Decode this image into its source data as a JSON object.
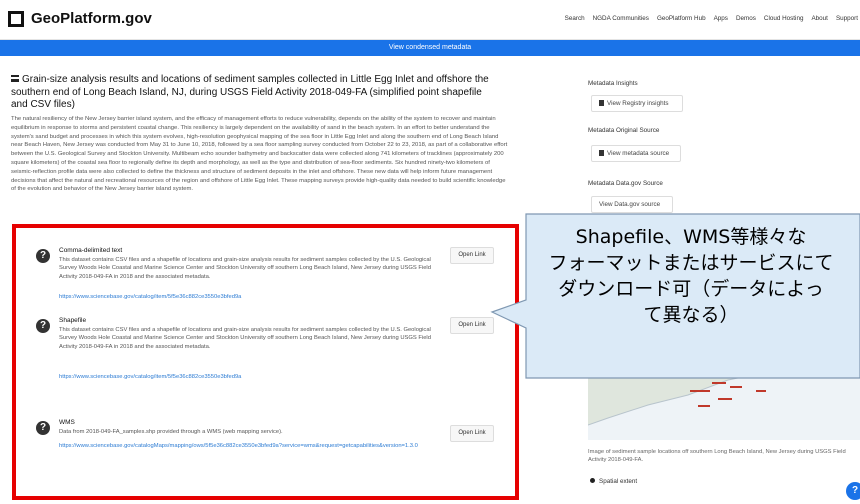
{
  "header": {
    "logo_text": "GeoPlatform.gov",
    "nav": [
      "Search",
      "NGDA Communities",
      "GeoPlatform Hub",
      "Apps",
      "Demos",
      "Cloud Hosting",
      "About",
      "Support"
    ]
  },
  "condensed_bar": "View condensed metadata",
  "main": {
    "title": "Grain-size analysis results and locations of sediment samples collected in Little Egg Inlet and offshore the southern end of Long Beach Island, NJ, during USGS Field Activity 2018-049-FA (simplified point shapefile and CSV files)",
    "description": "The natural resiliency of the New Jersey barrier island system, and the efficacy of management efforts to reduce vulnerability, depends on the ability of the system to recover and maintain equilibrium in response to storms and persistent coastal change. This resiliency is largely dependent on the availability of sand in the beach system. In an effort to better understand the system's sand budget and processes in which this system evolves, high-resolution geophysical mapping of the sea floor in Little Egg Inlet and along the southern end of Long Beach Island near Beach Haven, New Jersey was conducted from May 31 to June 10, 2018, followed by a sea floor sampling survey conducted from October 22 to 23, 2018, as part of a collaborative effort between the U.S. Geological Survey and Stockton University. Multibeam echo sounder bathymetry and backscatter data were collected along 741 kilometers of tracklines (approximately 200 square kilometers) of the coastal sea floor to regionally define its depth and morphology, as well as the type and distribution of sea-floor sediments. Six hundred ninety-two kilometers of seismic-reflection profile data were also collected to define the thickness and structure of sediment deposits in the inlet and offshore. These new data will help inform future management decisions that affect the natural and recreational resources of the region and offshore of Little Egg Inlet. These mapping surveys provide high-quality data needed to build scientific knowledge of the evolution and behavior of the New Jersey barrier island system."
  },
  "cards": [
    {
      "icon": "?",
      "title": "Comma-delimited text",
      "description": "This dataset contains CSV files and a shapefile of locations and grain-size analysis results for sediment samples collected by the U.S. Geological Survey Woods Hole Coastal and Marine Science Center and Stockton University off southern Long Beach Island, New Jersey during USGS Field Activity 2018-049-FA in 2018 and the associated metadata.",
      "link": "https://www.sciencebase.gov/catalog/item/5f5e36c882ce3550e3bfed9a",
      "button": "Open Link"
    },
    {
      "icon": "?",
      "title": "Shapefile",
      "description": "This dataset contains CSV files and a shapefile of locations and grain-size analysis results for sediment samples collected by the U.S. Geological Survey Woods Hole Coastal and Marine Science Center and Stockton University off southern Long Beach Island, New Jersey during USGS Field Activity 2018-049-FA in 2018 and the associated metadata.",
      "link": "https://www.sciencebase.gov/catalog/item/5f5e36c882ce3550e3bfed9a",
      "button": "Open Link"
    },
    {
      "icon": "?",
      "title": "WMS",
      "description": "Data from 2018-049-FA_samples.shp provided through a WMS (web mapping service).",
      "link": "https://www.sciencebase.gov/catalogMaps/mapping/ows/5f5e36c882ce3550e3bfed9a?service=wms&request=getcapabilities&version=1.3.0",
      "button": "Open Link"
    }
  ],
  "sidebar": {
    "insights_heading": "Metadata Insights",
    "insights_button": "View Registry insights",
    "original_heading": "Metadata Original Source",
    "original_button": "View metadata source",
    "datagov_heading": "Metadata Data.gov Source",
    "datagov_button": "View Data.gov source",
    "map_caption": "Image of sediment sample locations off southern Long Beach Island, New Jersey during USGS Field Activity 2018-049-FA.",
    "spatial_extent": "Spatial extent",
    "help": "?"
  },
  "callout": {
    "lines": [
      "Shapefile、WMS等様々な",
      "フォーマットまたはサービスにて",
      "ダウンロード可（データによっ",
      "て異なる）"
    ]
  },
  "colors": {
    "accent": "#1a73e8",
    "highlight_border": "#e60000",
    "link": "#2b7bd3"
  }
}
